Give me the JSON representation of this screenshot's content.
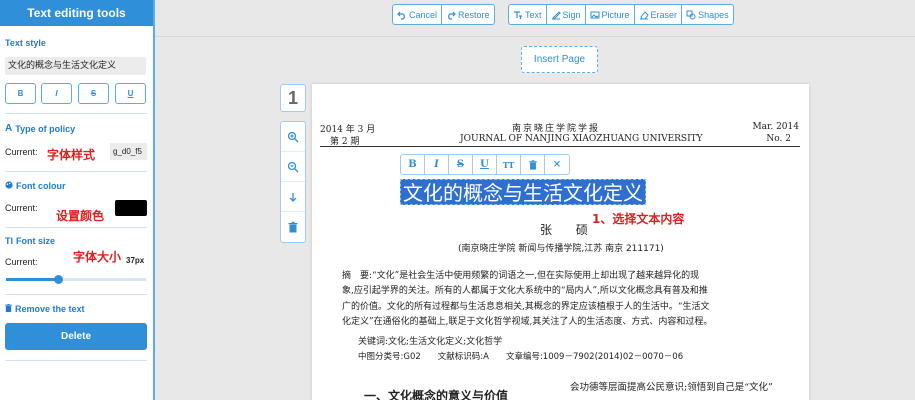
{
  "sidebar": {
    "title": "Text editing tools",
    "text_style_label": "Text style",
    "text_value": "文化的概念与生活文化定义",
    "format_buttons": [
      "B",
      "I",
      "S",
      "U"
    ],
    "policy_label": "Type of policy",
    "current_label": "Current:",
    "policy_value": "g_d0_f5",
    "font_colour_label": "Font colour",
    "font_colour_value": "#000000",
    "font_size_label": "Font size",
    "font_size_value": "37px",
    "font_size_fraction": 0.37,
    "remove_label": "Remove the text",
    "delete_label": "Delete"
  },
  "annotations": {
    "font_style": "字体样式",
    "set_color": "设置颜色",
    "font_size": "字体大小",
    "select_text": "1、选择文本内容"
  },
  "toolbar": {
    "cancel": "Cancel",
    "restore": "Restore",
    "text": "Text",
    "sign": "Sign",
    "picture": "Picture",
    "eraser": "Eraser",
    "shapes": "Shapes",
    "insert_page": "Insert Page"
  },
  "page_tools": {
    "page_number": "1"
  },
  "float_bar": [
    "B",
    "I",
    "S",
    "U",
    "TT",
    "trash",
    "×"
  ],
  "document": {
    "date": "2014 年 3 月",
    "issue": "第 2 期",
    "journal_cn": "南京晓庄学院学报",
    "journal_en": "JOURNAL OF NANJING XIAOZHUANG UNIVERSITY",
    "date_en": "Mar. 2014",
    "no_en": "No. 2",
    "title": "文化的概念与生活文化定义",
    "author": "张 硕",
    "affiliation": "(南京晓庄学院 新闻与传播学院,江苏 南京 211171)",
    "abstract_lines": [
      "摘　要:“文化”是社会生活中使用频繁的词语之一,但在实际使用上却出现了越来越异化的现",
      "象,应引起学界的关注。所有的人都属于文化大系统中的“局内人”,所以文化概念具有普及和推",
      "广的价值。文化的所有过程都与生活息息相关,其概念的界定应该植根于人的生活中。“生活文",
      "化定义”在通俗化的基础上,联足于文化哲学视域,其关注了人的生活态度、方式、内容和过程。"
    ],
    "keywords": "关键词:文化;生活文化定义;文化哲学",
    "classification": "中图分类号:G02　　文献标识码:A　　文章编号:1009－7902(2014)02－0070－06",
    "section_title": "一、文化概念的意义与价值",
    "right_col": "会功德等层面提高公民意识;领悟到自己是“文化”"
  }
}
